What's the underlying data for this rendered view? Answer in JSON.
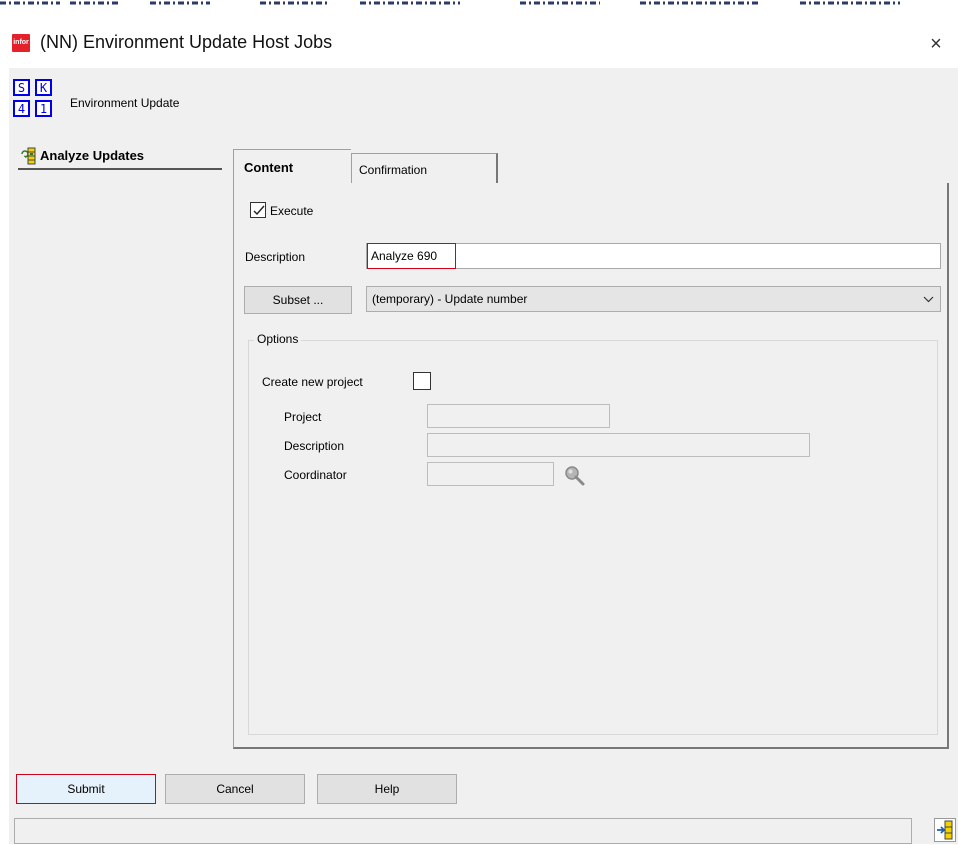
{
  "window": {
    "title": "(NN) Environment Update Host Jobs",
    "logo_text": "infor",
    "close_label": "×"
  },
  "app": {
    "icon_letters": [
      "S",
      "K",
      "4",
      "1"
    ],
    "name": "Environment Update"
  },
  "nav": {
    "items": [
      {
        "label": "Analyze Updates",
        "icon": "analyze-updates-icon"
      }
    ]
  },
  "tabs": [
    {
      "label": "Content",
      "active": true
    },
    {
      "label": "Confirmation",
      "active": false
    }
  ],
  "content": {
    "execute": {
      "label": "Execute",
      "checked": true
    },
    "description": {
      "label": "Description",
      "value": "Analyze 690"
    },
    "subset": {
      "button_label": "Subset ...",
      "selected": "(temporary) - Update number"
    },
    "options": {
      "title": "Options",
      "create_new_project": {
        "label": "Create new project",
        "checked": false
      },
      "project": {
        "label": "Project",
        "value": ""
      },
      "description": {
        "label": "Description",
        "value": ""
      },
      "coordinator": {
        "label": "Coordinator",
        "value": ""
      }
    }
  },
  "buttons": {
    "submit": "Submit",
    "cancel": "Cancel",
    "help": "Help"
  },
  "colors": {
    "accent_red": "#d0021b",
    "logo_red": "#e4202a",
    "icon_blue": "#0000ee",
    "panel_bg": "#f0f0f0"
  }
}
